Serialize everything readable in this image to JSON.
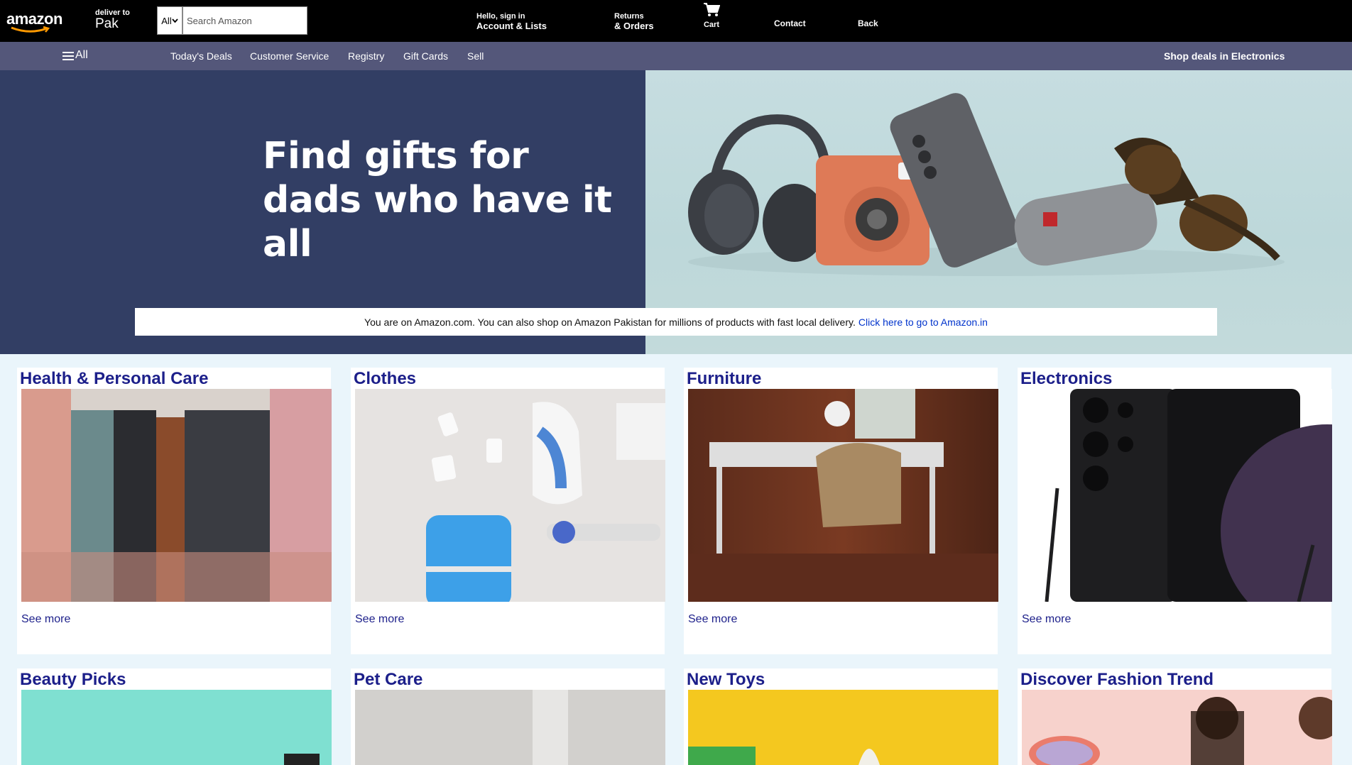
{
  "header": {
    "logo": "amazon",
    "deliver_small": "deliver to",
    "deliver_big": "Pak",
    "search_category": "All",
    "search_placeholder": "Search Amazon",
    "account_small": "Hello, sign in",
    "account_big": "Account & Lists",
    "returns_small": "Returns",
    "returns_big": "& Orders",
    "cart": "Cart",
    "contact": "Contact",
    "back": "Back"
  },
  "subnav": {
    "all": "All",
    "links": [
      "Today's Deals",
      "Customer Service",
      "Registry",
      "Gift Cards",
      "Sell"
    ],
    "deal": "Shop deals in Electronics"
  },
  "hero": {
    "line1": "Find gifts for",
    "line2": "dads who have it all",
    "notice_text": "You are on Amazon.com. You can also shop on Amazon Pakistan for millions of products with fast local delivery.",
    "notice_link": "Click here to go to Amazon.in"
  },
  "cards": [
    {
      "title": "Health & Personal Care",
      "more": "See more"
    },
    {
      "title": "Clothes",
      "more": "See more"
    },
    {
      "title": "Furniture",
      "more": "See more"
    },
    {
      "title": "Electronics",
      "more": "See more"
    },
    {
      "title": "Beauty Picks"
    },
    {
      "title": "Pet Care"
    },
    {
      "title": "New Toys"
    },
    {
      "title": "Discover Fashion Trend"
    }
  ],
  "colors": {
    "topbar": "#000000",
    "subnav": "#54577a",
    "hero_left": "#323e64",
    "card_title": "#1c1f8a",
    "link": "#0033cc"
  }
}
